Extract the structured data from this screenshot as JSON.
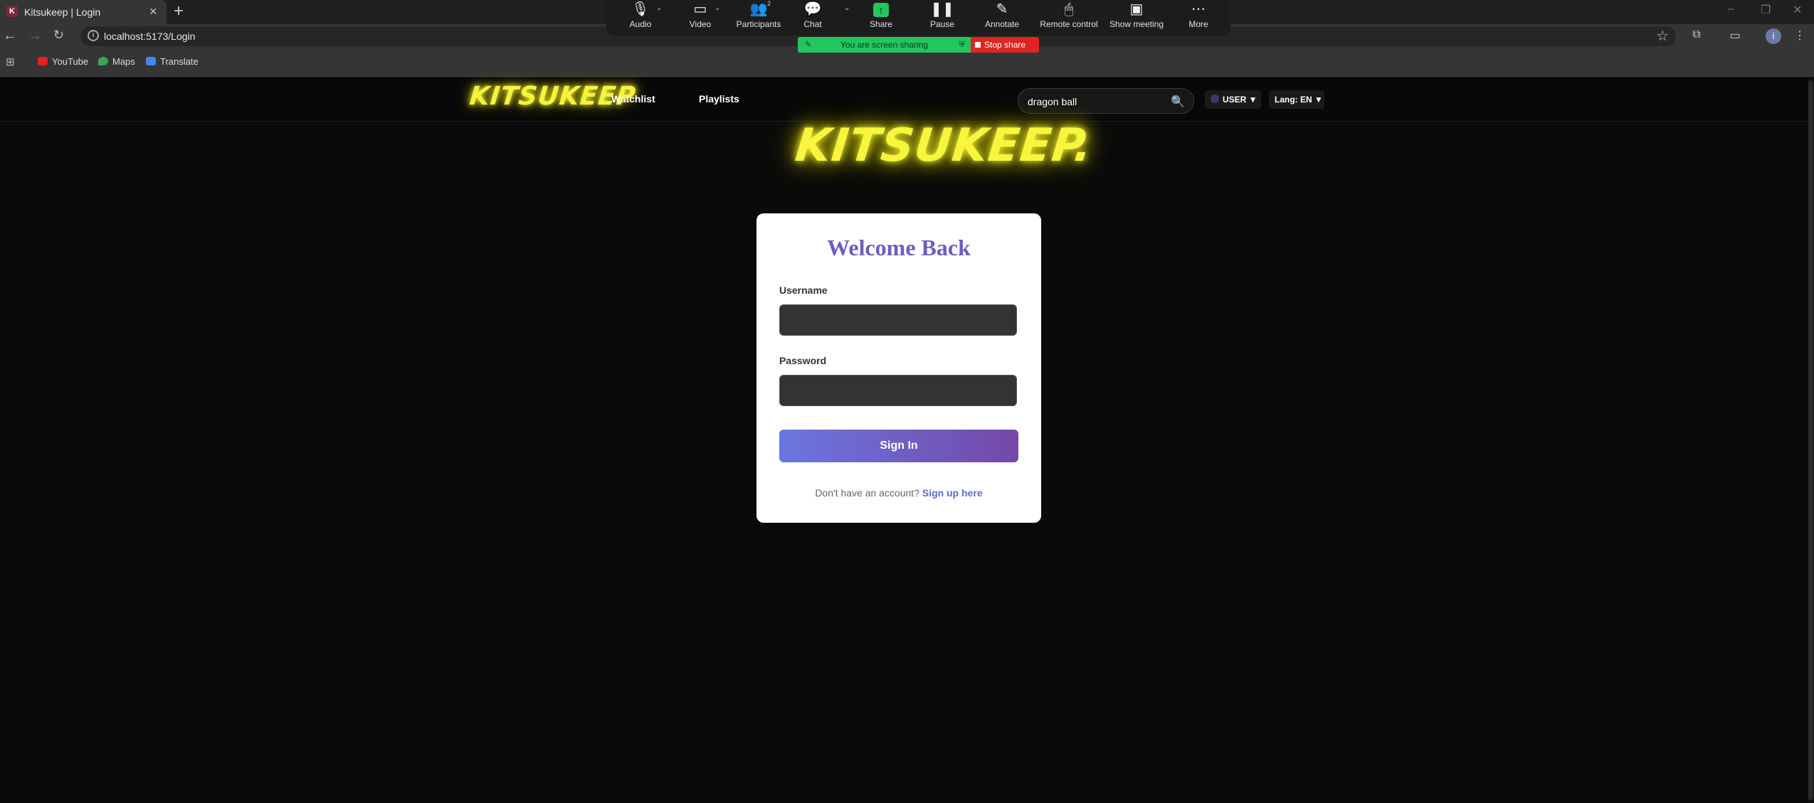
{
  "browser": {
    "tab_title": "Kitsukeep | Login",
    "tab_favicon": "K",
    "url": "localhost:5173/Login",
    "bookmarks": [
      "YouTube",
      "Maps",
      "Translate"
    ]
  },
  "zoom": {
    "controls": [
      "Audio",
      "Video",
      "Participants",
      "Chat",
      "Share",
      "Pause",
      "Annotate",
      "Remote control",
      "Show meeting",
      "More"
    ],
    "participants_count": "2",
    "sharing_text": "You are screen sharing",
    "stop_label": "Stop share"
  },
  "site": {
    "logo": "KITSUKEEP",
    "nav": [
      "Watchlist",
      "Playlists"
    ],
    "search_value": "dragon ball",
    "user_label": "USER ▼",
    "lang_label": "Lang: EN ▼",
    "hero_logo": "KITSUKEEP."
  },
  "login": {
    "title": "Welcome Back",
    "username_label": "Username",
    "password_label": "Password",
    "submit": "Sign In",
    "signup_prompt": "Don't have an account?",
    "signup_link": "Sign up here"
  },
  "colors": {
    "logo_glow": "#f5f33a",
    "title_purple": "#6a5fc0",
    "button_gradient_start": "#6b77e0",
    "button_gradient_end": "#7448a8",
    "share_green": "#22c55e",
    "stop_red": "#e02424"
  }
}
